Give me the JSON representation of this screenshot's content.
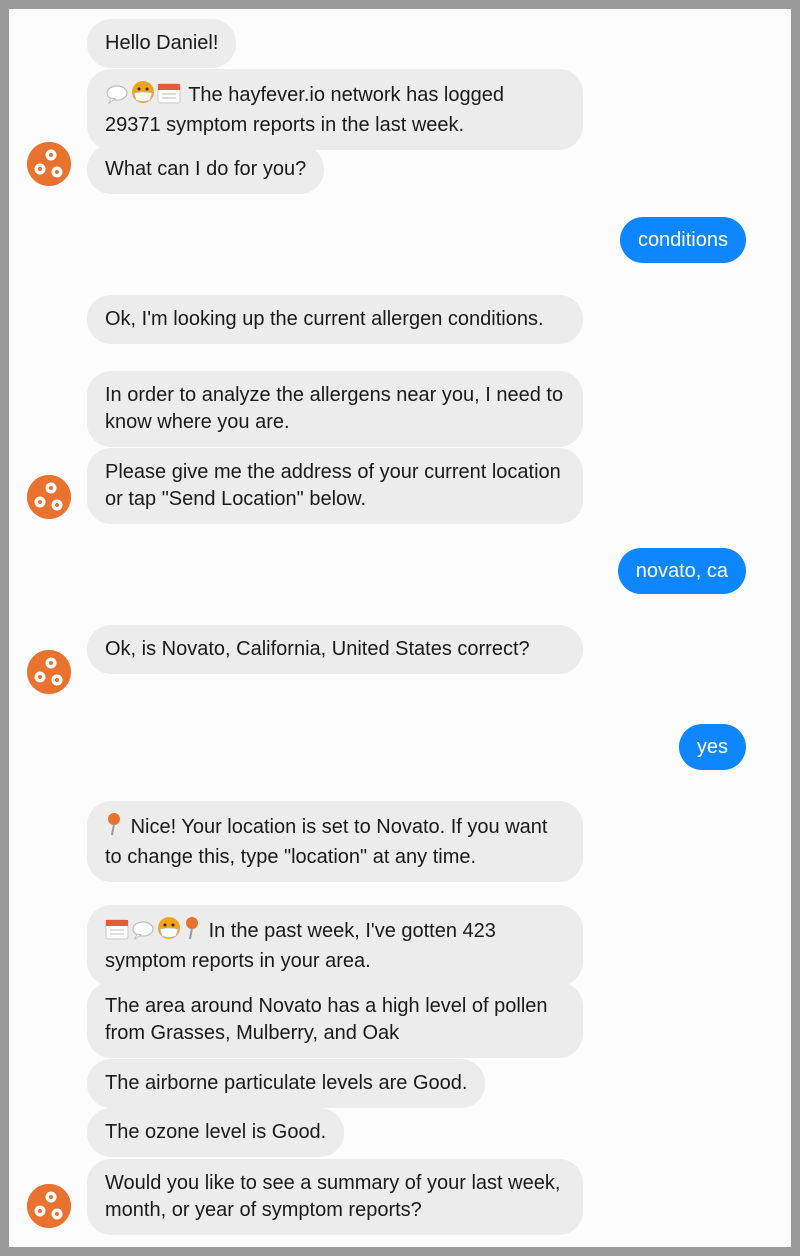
{
  "colors": {
    "bot_bubble": "#ececec",
    "user_bubble": "#0e86ff",
    "avatar": "#e8722e",
    "frame_border": "#999999"
  },
  "messages": {
    "m1": "Hello Daniel!",
    "m2": "The hayfever.io network has logged 29371 symptom reports in the last week.",
    "m2_icons": [
      "speech-bubble-icon",
      "face-with-mask-icon",
      "calendar-icon"
    ],
    "m3": "What can I do for you?",
    "u1": "conditions",
    "m4": "Ok, I'm looking up the current allergen conditions.",
    "m5": "In order to analyze the allergens near you, I need to know where you are.",
    "m6": "Please give me the address of your current location or tap \"Send Location\" below.",
    "u2": "novato, ca",
    "m7": "Ok, is Novato, California, United States correct?",
    "u3": "yes",
    "m8": "Nice! Your location is set to Novato. If you want to change this, type \"location\" at any time.",
    "m8_icons": [
      "pushpin-icon"
    ],
    "m9": "In the past week, I've gotten 423 symptom reports in your area.",
    "m9_icons": [
      "calendar-icon",
      "speech-bubble-icon",
      "face-with-mask-icon",
      "pushpin-icon"
    ],
    "m10": "The area around Novato has a high level of pollen from Grasses, Mulberry, and Oak",
    "m11": "The airborne particulate levels are Good.",
    "m12": "The ozone level is Good.",
    "m13": "Would you like to see a summary of your last week, month, or year of symptom reports?"
  }
}
